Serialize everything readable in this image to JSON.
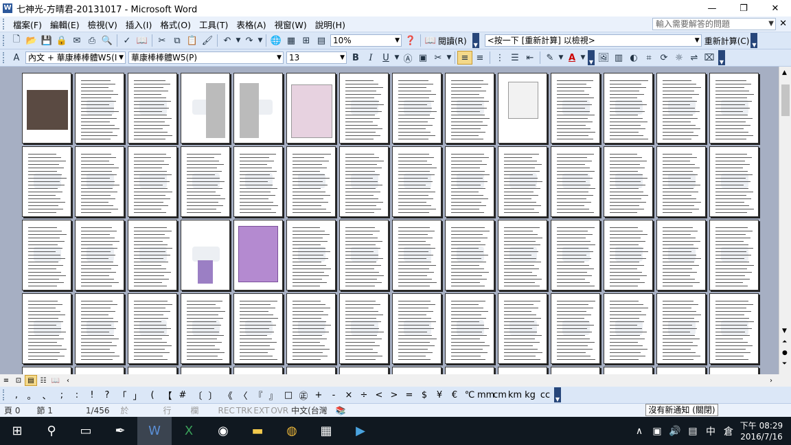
{
  "window": {
    "title": "七神光-方晴君-20131017 - Microsoft Word",
    "min": "—",
    "restore": "❐",
    "close": "✕"
  },
  "menu": [
    "檔案(F)",
    "編輯(E)",
    "檢視(V)",
    "插入(I)",
    "格式(O)",
    "工具(T)",
    "表格(A)",
    "視窗(W)",
    "說明(H)"
  ],
  "help_box": {
    "placeholder": "輸入需要解答的問題"
  },
  "doc_close": "✕",
  "toolbar1": {
    "zoom": "10%",
    "reading": "閱讀(R)",
    "field_combo": "<按一下 [重新計算] 以檢視>",
    "recalc": "重新計算(C)"
  },
  "toolbar2": {
    "style": "內文 + 華康棒棒體W5(I",
    "font": "華康棒棒體W5(P)",
    "size": "13",
    "bold": "B",
    "italic": "I",
    "underline": "U",
    "font_color_letter": "A"
  },
  "symbols": [
    ",",
    "。",
    "、",
    ";",
    ":",
    "!",
    "?",
    "「",
    "」",
    "(",
    "【",
    "#",
    "〔",
    "〕",
    "《",
    "〈",
    "『",
    "』",
    "□",
    "㊣",
    "+",
    "-",
    "×",
    "÷",
    "<",
    ">",
    "=",
    "$",
    "¥",
    "€",
    "℃",
    "mm",
    "cm",
    "km",
    "kg",
    "cc"
  ],
  "status": {
    "page": "頁 0",
    "section": "節 1",
    "pages": "1/456",
    "at": "於",
    "line": "行",
    "col": "欄",
    "rec": "REC",
    "trk": "TRK",
    "ext": "EXT",
    "ovr": "OVR",
    "lang": "中文(台灣"
  },
  "notification": "沒有新通知 (關閉)",
  "clock": {
    "time": "下午 08:29",
    "date": "2016/7/16"
  },
  "tray_ime": "中",
  "colors": {
    "accent": "#2b579a",
    "doc_bg": "#a6afc3",
    "taskbar": "#101820",
    "toolbar": "#dbe7f7"
  }
}
